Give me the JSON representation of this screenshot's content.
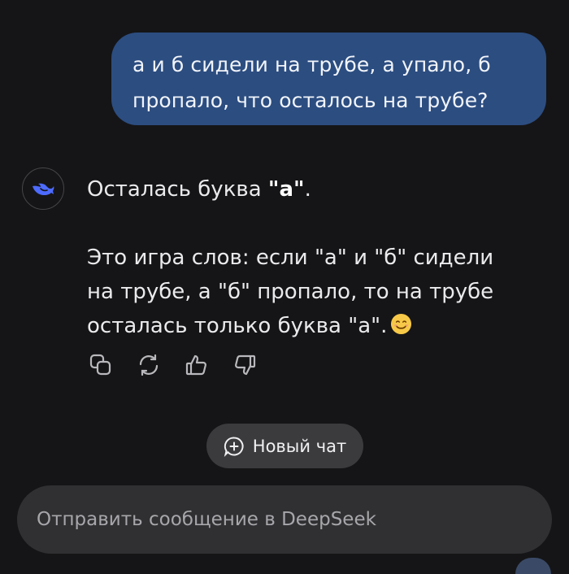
{
  "user_message": {
    "line1": "а и б сидели на трубе, а упало, б",
    "line2": "пропало, что осталось на трубе?"
  },
  "assistant": {
    "avatar_icon": "deepseek-whale-icon",
    "answer_prefix": "Осталась буква ",
    "answer_bold": "\"а\"",
    "answer_suffix": ".",
    "explanation_line1": "Это игра слов: если \"а\" и \"б\" сидели",
    "explanation_line2": "на трубе, а \"б\" пропало, то на трубе",
    "explanation_line3": "осталась только буква \"а\".",
    "emoji": "smiling-face-emoji"
  },
  "actions": [
    {
      "name": "copy-icon"
    },
    {
      "name": "regenerate-icon"
    },
    {
      "name": "thumbs-up-icon"
    },
    {
      "name": "thumbs-down-icon"
    }
  ],
  "new_chat": {
    "label": "Новый чат"
  },
  "composer": {
    "placeholder": "Отправить сообщение в DeepSeek"
  },
  "colors": {
    "background": "#151517",
    "user_bubble": "#2c4d80",
    "accent_blue": "#4d6bfe",
    "pill": "#3b3b3e",
    "composer": "#303033"
  }
}
